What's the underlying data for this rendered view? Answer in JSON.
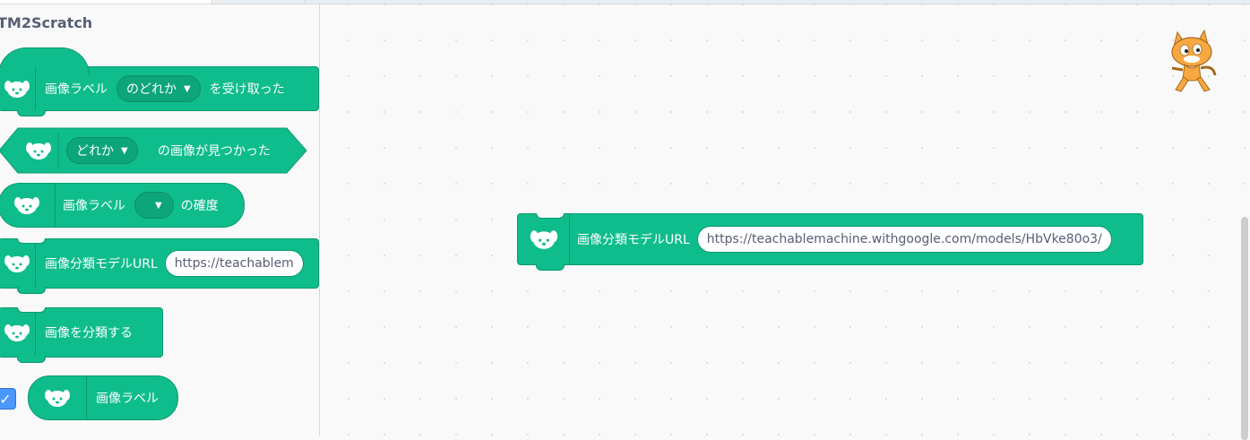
{
  "category": {
    "title": "TM2Scratch"
  },
  "palette_blocks": {
    "when_label_received": {
      "prefix": "画像ラベル",
      "dropdown": "のどれか",
      "suffix": "を受け取った"
    },
    "when_label_found": {
      "dropdown": "どれか",
      "suffix": "の画像が見つかった"
    },
    "label_confidence": {
      "prefix": "画像ラベル",
      "dropdown": "",
      "suffix": "の確度"
    },
    "set_model_url": {
      "label": "画像分類モデルURL",
      "value": "https://teachablem"
    },
    "classify_image": {
      "label": "画像を分類する"
    },
    "image_label_reporter": {
      "label": "画像ラベル",
      "checked": true
    }
  },
  "workspace": {
    "model_url_block": {
      "label": "画像分類モデルURL",
      "value": "https://teachablemachine.withgoogle.com/models/HbVke80o3/"
    }
  },
  "icons": {
    "extension": "dog-icon",
    "dropdown": "triangle-down-icon",
    "sprite": "scratch-cat-icon",
    "check": "checkmark-icon"
  },
  "colors": {
    "block": "#0fbd8c",
    "block_border": "#0b9a6f",
    "category_title": "#575e75",
    "checkbox": "#4c97ff"
  }
}
